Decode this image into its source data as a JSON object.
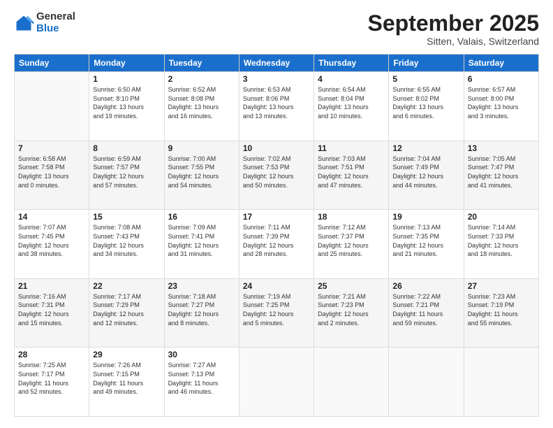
{
  "logo": {
    "general": "General",
    "blue": "Blue"
  },
  "header": {
    "month": "September 2025",
    "location": "Sitten, Valais, Switzerland"
  },
  "weekdays": [
    "Sunday",
    "Monday",
    "Tuesday",
    "Wednesday",
    "Thursday",
    "Friday",
    "Saturday"
  ],
  "weeks": [
    [
      {
        "day": "",
        "info": ""
      },
      {
        "day": "1",
        "info": "Sunrise: 6:50 AM\nSunset: 8:10 PM\nDaylight: 13 hours\nand 19 minutes."
      },
      {
        "day": "2",
        "info": "Sunrise: 6:52 AM\nSunset: 8:08 PM\nDaylight: 13 hours\nand 16 minutes."
      },
      {
        "day": "3",
        "info": "Sunrise: 6:53 AM\nSunset: 8:06 PM\nDaylight: 13 hours\nand 13 minutes."
      },
      {
        "day": "4",
        "info": "Sunrise: 6:54 AM\nSunset: 8:04 PM\nDaylight: 13 hours\nand 10 minutes."
      },
      {
        "day": "5",
        "info": "Sunrise: 6:55 AM\nSunset: 8:02 PM\nDaylight: 13 hours\nand 6 minutes."
      },
      {
        "day": "6",
        "info": "Sunrise: 6:57 AM\nSunset: 8:00 PM\nDaylight: 13 hours\nand 3 minutes."
      }
    ],
    [
      {
        "day": "7",
        "info": "Sunrise: 6:58 AM\nSunset: 7:58 PM\nDaylight: 13 hours\nand 0 minutes."
      },
      {
        "day": "8",
        "info": "Sunrise: 6:59 AM\nSunset: 7:57 PM\nDaylight: 12 hours\nand 57 minutes."
      },
      {
        "day": "9",
        "info": "Sunrise: 7:00 AM\nSunset: 7:55 PM\nDaylight: 12 hours\nand 54 minutes."
      },
      {
        "day": "10",
        "info": "Sunrise: 7:02 AM\nSunset: 7:53 PM\nDaylight: 12 hours\nand 50 minutes."
      },
      {
        "day": "11",
        "info": "Sunrise: 7:03 AM\nSunset: 7:51 PM\nDaylight: 12 hours\nand 47 minutes."
      },
      {
        "day": "12",
        "info": "Sunrise: 7:04 AM\nSunset: 7:49 PM\nDaylight: 12 hours\nand 44 minutes."
      },
      {
        "day": "13",
        "info": "Sunrise: 7:05 AM\nSunset: 7:47 PM\nDaylight: 12 hours\nand 41 minutes."
      }
    ],
    [
      {
        "day": "14",
        "info": "Sunrise: 7:07 AM\nSunset: 7:45 PM\nDaylight: 12 hours\nand 38 minutes."
      },
      {
        "day": "15",
        "info": "Sunrise: 7:08 AM\nSunset: 7:43 PM\nDaylight: 12 hours\nand 34 minutes."
      },
      {
        "day": "16",
        "info": "Sunrise: 7:09 AM\nSunset: 7:41 PM\nDaylight: 12 hours\nand 31 minutes."
      },
      {
        "day": "17",
        "info": "Sunrise: 7:11 AM\nSunset: 7:39 PM\nDaylight: 12 hours\nand 28 minutes."
      },
      {
        "day": "18",
        "info": "Sunrise: 7:12 AM\nSunset: 7:37 PM\nDaylight: 12 hours\nand 25 minutes."
      },
      {
        "day": "19",
        "info": "Sunrise: 7:13 AM\nSunset: 7:35 PM\nDaylight: 12 hours\nand 21 minutes."
      },
      {
        "day": "20",
        "info": "Sunrise: 7:14 AM\nSunset: 7:33 PM\nDaylight: 12 hours\nand 18 minutes."
      }
    ],
    [
      {
        "day": "21",
        "info": "Sunrise: 7:16 AM\nSunset: 7:31 PM\nDaylight: 12 hours\nand 15 minutes."
      },
      {
        "day": "22",
        "info": "Sunrise: 7:17 AM\nSunset: 7:29 PM\nDaylight: 12 hours\nand 12 minutes."
      },
      {
        "day": "23",
        "info": "Sunrise: 7:18 AM\nSunset: 7:27 PM\nDaylight: 12 hours\nand 8 minutes."
      },
      {
        "day": "24",
        "info": "Sunrise: 7:19 AM\nSunset: 7:25 PM\nDaylight: 12 hours\nand 5 minutes."
      },
      {
        "day": "25",
        "info": "Sunrise: 7:21 AM\nSunset: 7:23 PM\nDaylight: 12 hours\nand 2 minutes."
      },
      {
        "day": "26",
        "info": "Sunrise: 7:22 AM\nSunset: 7:21 PM\nDaylight: 11 hours\nand 59 minutes."
      },
      {
        "day": "27",
        "info": "Sunrise: 7:23 AM\nSunset: 7:19 PM\nDaylight: 11 hours\nand 55 minutes."
      }
    ],
    [
      {
        "day": "28",
        "info": "Sunrise: 7:25 AM\nSunset: 7:17 PM\nDaylight: 11 hours\nand 52 minutes."
      },
      {
        "day": "29",
        "info": "Sunrise: 7:26 AM\nSunset: 7:15 PM\nDaylight: 11 hours\nand 49 minutes."
      },
      {
        "day": "30",
        "info": "Sunrise: 7:27 AM\nSunset: 7:13 PM\nDaylight: 11 hours\nand 46 minutes."
      },
      {
        "day": "",
        "info": ""
      },
      {
        "day": "",
        "info": ""
      },
      {
        "day": "",
        "info": ""
      },
      {
        "day": "",
        "info": ""
      }
    ]
  ]
}
